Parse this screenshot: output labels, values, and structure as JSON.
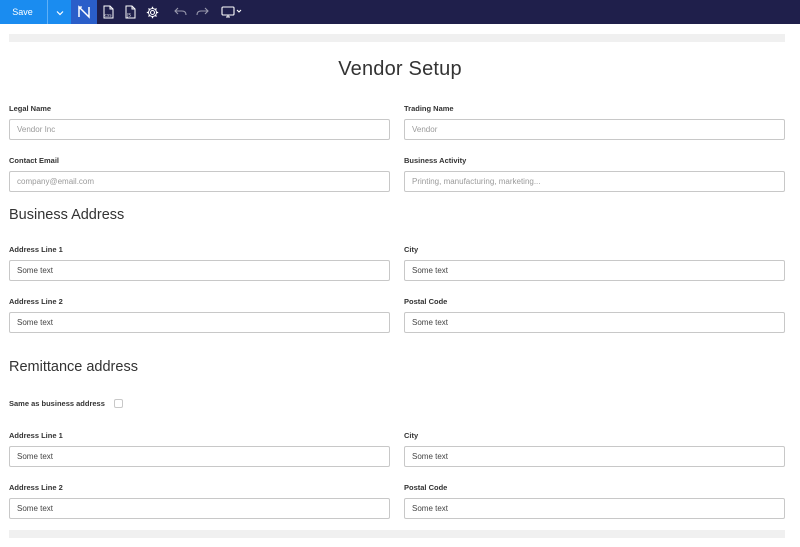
{
  "toolbar": {
    "save_label": "Save",
    "icons": [
      "chevron-down-icon",
      "logo-icon",
      "css-file-icon",
      "js-file-icon",
      "gear-icon",
      "undo-icon",
      "redo-icon",
      "monitor-icon"
    ]
  },
  "form": {
    "title": "Vendor Setup",
    "fields": {
      "legal_name": {
        "label": "Legal Name",
        "placeholder": "Vendor Inc"
      },
      "trading_name": {
        "label": "Trading Name",
        "placeholder": "Vendor"
      },
      "contact_email": {
        "label": "Contact Email",
        "placeholder": "company@email.com"
      },
      "business_activity": {
        "label": "Business Activity",
        "placeholder": "Printing, manufacturing, marketing..."
      }
    },
    "business_address": {
      "heading": "Business Address",
      "address_line_1": {
        "label": "Address Line 1",
        "value": "Some text"
      },
      "city": {
        "label": "City",
        "value": "Some text"
      },
      "address_line_2": {
        "label": "Address Line 2",
        "value": "Some text"
      },
      "postal_code": {
        "label": "Postal Code",
        "value": "Some text"
      }
    },
    "remittance_address": {
      "heading": "Remittance address",
      "same_as_label": "Same as business address",
      "same_as_checked": false,
      "address_line_1": {
        "label": "Address Line 1",
        "value": "Some text"
      },
      "city": {
        "label": "City",
        "value": "Some text"
      },
      "address_line_2": {
        "label": "Address Line 2",
        "value": "Some text"
      },
      "postal_code": {
        "label": "Postal Code",
        "value": "Some text"
      }
    }
  },
  "colors": {
    "toolbar_bg": "#1f1f4b",
    "accent": "#1a8cf0",
    "active_icon_bg": "#2a5ec9"
  }
}
